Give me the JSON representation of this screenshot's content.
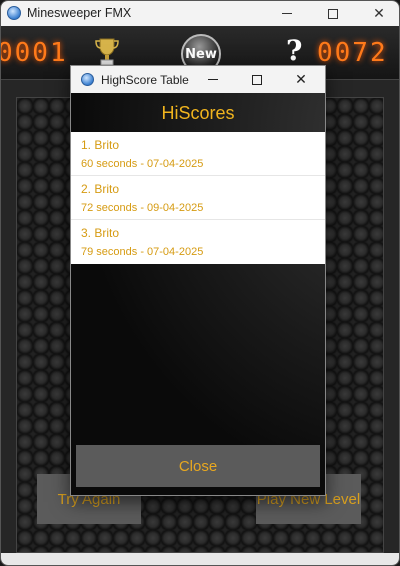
{
  "window": {
    "title": "Minesweeper FMX"
  },
  "toolbar": {
    "mines_counter": "0001",
    "timer_counter": "0072",
    "new_label": "New",
    "help_label": "?"
  },
  "game_buttons": {
    "try_again": "Try Again",
    "play_new_level": "Play New Level"
  },
  "dialog": {
    "title": "HighScore Table",
    "heading": "HiScores",
    "scores": [
      {
        "name": "1. Brito",
        "detail": "60 seconds - 07-04-2025"
      },
      {
        "name": "2. Brito",
        "detail": "72 seconds - 09-04-2025"
      },
      {
        "name": "3. Brito",
        "detail": "79 seconds - 07-04-2025"
      }
    ],
    "close_label": "Close"
  },
  "colors": {
    "accent": "#f0b41e",
    "counter": "#ff7a1a",
    "button_bg": "#5b5b5b"
  }
}
